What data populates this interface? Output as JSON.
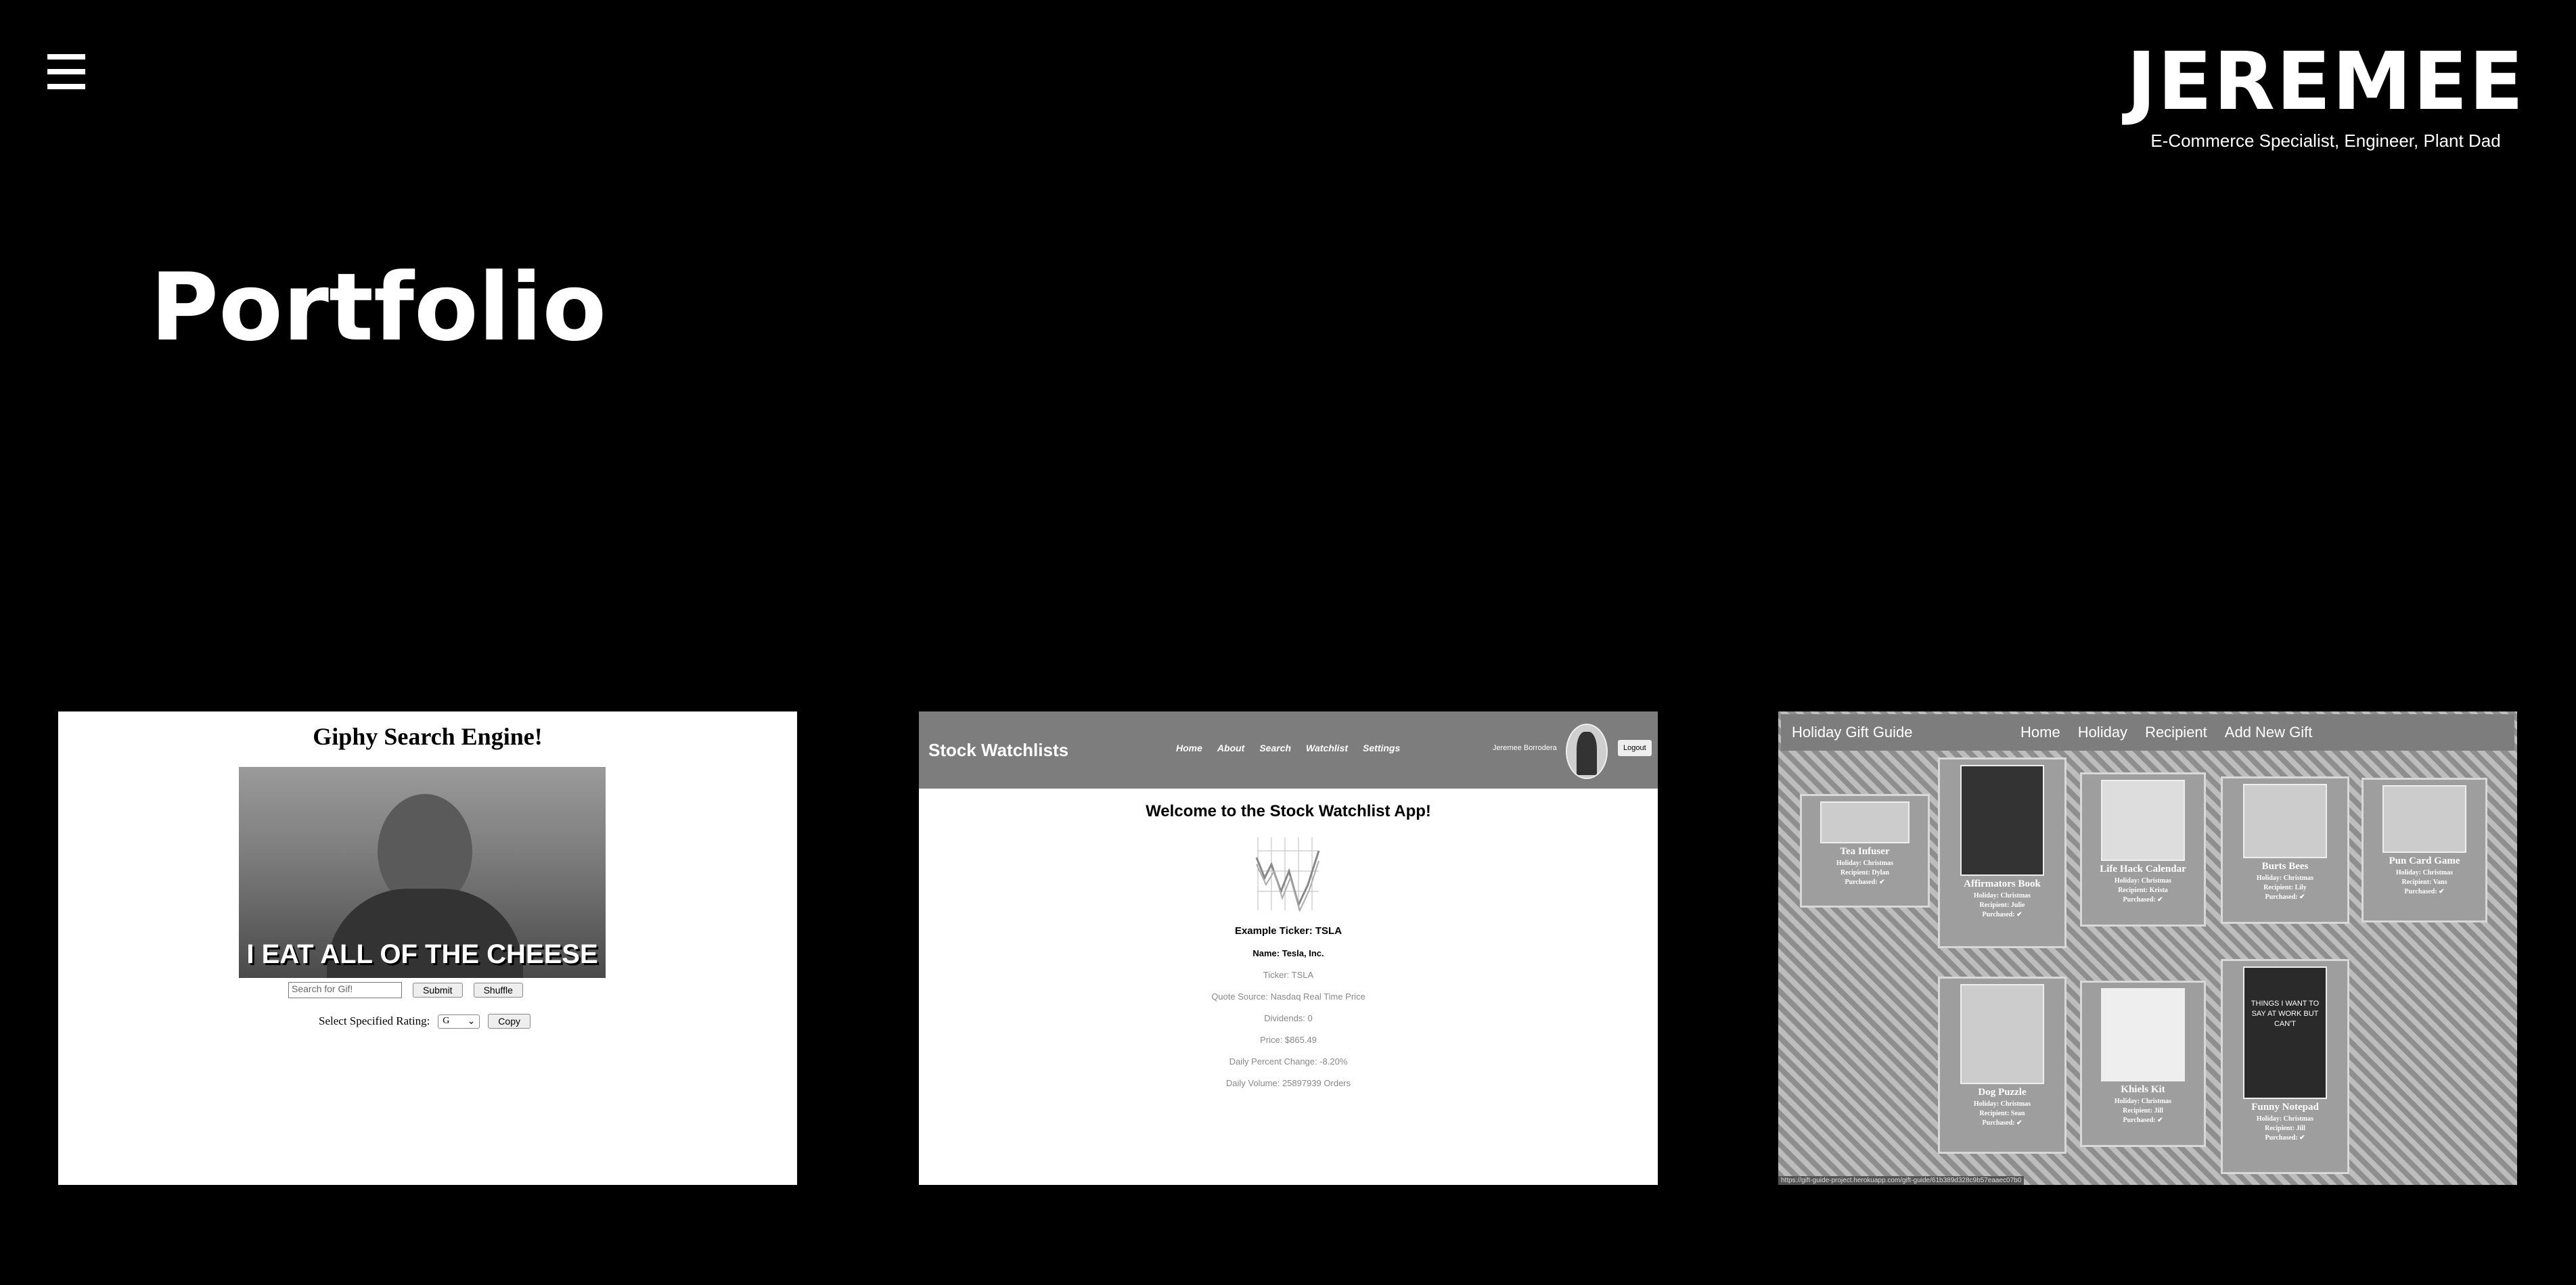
{
  "header": {
    "brand_name": "JEREMEE",
    "tagline": "E-Commerce Specialist, Engineer, Plant Dad"
  },
  "page": {
    "title": "Portfolio"
  },
  "projects": [
    {
      "title": "Giphy Search Engine!",
      "gif_caption": "I EAT ALL OF THE CHEESE",
      "search_placeholder": "Search for Gif!",
      "submit_label": "Submit",
      "shuffle_label": "Shuffle",
      "rating_label": "Select Specified Rating:",
      "rating_value": "G",
      "copy_label": "Copy"
    },
    {
      "brand": "Stock Watchlists",
      "nav": [
        "Home",
        "About",
        "Search",
        "Watchlist",
        "Settings"
      ],
      "user": "Jeremee Borrodera",
      "logout": "Logout",
      "welcome": "Welcome to the Stock Watchlist App!",
      "example_ticker": "Example Ticker: TSLA",
      "name": "Name: Tesla, Inc.",
      "ticker": "Ticker: TSLA",
      "quote_source": "Quote Source: Nasdaq Real Time Price",
      "dividends": "Dividends: 0",
      "price": "Price: $865.49",
      "daily_change": "Daily Percent Change: -8.20%",
      "daily_volume": "Daily Volume: 25897939 Orders"
    },
    {
      "brand": "Holiday Gift Guide",
      "nav": [
        "Home",
        "Holiday",
        "Recipient",
        "Add New Gift"
      ],
      "gifts": [
        {
          "name": "Tea Infuser",
          "holiday": "Holiday: Christmas",
          "recipient": "Recipient: Dylan",
          "purchased": "Purchased: ✔"
        },
        {
          "name": "Affirmators Book",
          "holiday": "Holiday: Christmas",
          "recipient": "Recipient: Julie",
          "purchased": "Purchased: ✔"
        },
        {
          "name": "Life Hack Calendar",
          "holiday": "Holiday: Christmas",
          "recipient": "Recipient: Krista",
          "purchased": "Purchased: ✔"
        },
        {
          "name": "Burts Bees",
          "holiday": "Holiday: Christmas",
          "recipient": "Recipient: Lily",
          "purchased": "Purchased: ✔"
        },
        {
          "name": "Pun Card Game",
          "holiday": "Holiday: Christmas",
          "recipient": "Recipient: Vans",
          "purchased": "Purchased: ✔"
        },
        {
          "name": "Dog Puzzle",
          "holiday": "Holiday: Christmas",
          "recipient": "Recipient: Sean",
          "purchased": "Purchased: ✔"
        },
        {
          "name": "Khiels Kit",
          "holiday": "Holiday: Christmas",
          "recipient": "Recipient: Jill",
          "purchased": "Purchased: ✔"
        },
        {
          "name": "Funny Notepad",
          "holiday": "Holiday: Christmas",
          "recipient": "Recipient: Jill",
          "purchased": "Purchased: ✔"
        }
      ],
      "notepad_text": "THINGS I WANT TO SAY AT WORK BUT CAN'T",
      "status_url": "https://gift-guide-project.herokuapp.com/gift-guide/61b389d328c9b57eaaec07b0"
    }
  ]
}
